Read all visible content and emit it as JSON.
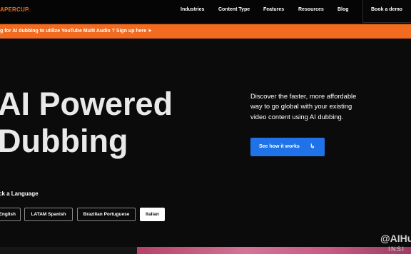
{
  "nav": {
    "logo": "APERCUP.",
    "links": [
      "Industries",
      "Content Type",
      "Features",
      "Resources",
      "Blog"
    ],
    "book_demo": "Book a demo"
  },
  "banner": {
    "text_start": "g for AI dubbing to utilize",
    "highlight": "YouTube Multi Audio",
    "text_end": "? Sign up here ➤"
  },
  "hero": {
    "title_line1": "AI Powered",
    "title_line2": "Dubbing",
    "description": "Discover the faster, more affordable way to go global with your existing video content using AI dubbing.",
    "cta_label": "See how it works",
    "cta_icon": "↳"
  },
  "language": {
    "heading": "ck a Language",
    "options": [
      "English",
      "LATAM Spanish",
      "Brazilian Portuguese",
      "Italian"
    ],
    "selected": "Italian"
  },
  "watermark": {
    "handle": "@AIHu",
    "sub": "INSI"
  },
  "colors": {
    "accent_orange": "#f36b21",
    "cta_blue": "#1f72e8",
    "background": "#0b0b0b"
  }
}
